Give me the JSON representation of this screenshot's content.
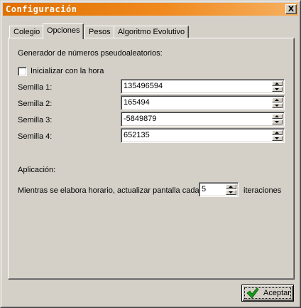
{
  "window": {
    "title": "Configuración",
    "close_glyph": "X"
  },
  "tabs": [
    {
      "label": "Colegio"
    },
    {
      "label": "Opciones"
    },
    {
      "label": "Pesos"
    },
    {
      "label": "Algoritmo Evolutivo"
    }
  ],
  "active_tab": "Opciones",
  "random": {
    "heading": "Generador de números pseudoaleatorios:",
    "init_with_time_label": "Inicializar con la hora",
    "init_with_time_checked": false,
    "seeds": [
      {
        "label": "Semilla 1:",
        "value": "135496594"
      },
      {
        "label": "Semilla 2:",
        "value": "165494"
      },
      {
        "label": "Semilla 3:",
        "value": "-5849879"
      },
      {
        "label": "Semilla 4:",
        "value": "652135"
      }
    ]
  },
  "application": {
    "heading": "Aplicación:",
    "refresh_prefix": "Mientras se elabora horario, actualizar pantalla cada",
    "refresh_value": "5",
    "refresh_suffix": "iteraciones"
  },
  "buttons": {
    "accept_label": "Aceptar"
  },
  "colors": {
    "title_start": "#e07000",
    "title_end": "#f6b060",
    "face": "#d4d0c8",
    "check_green": "#1a9a1a"
  },
  "icons": [
    "close-icon",
    "checkmark-icon",
    "spin-up-icon",
    "spin-down-icon"
  ]
}
